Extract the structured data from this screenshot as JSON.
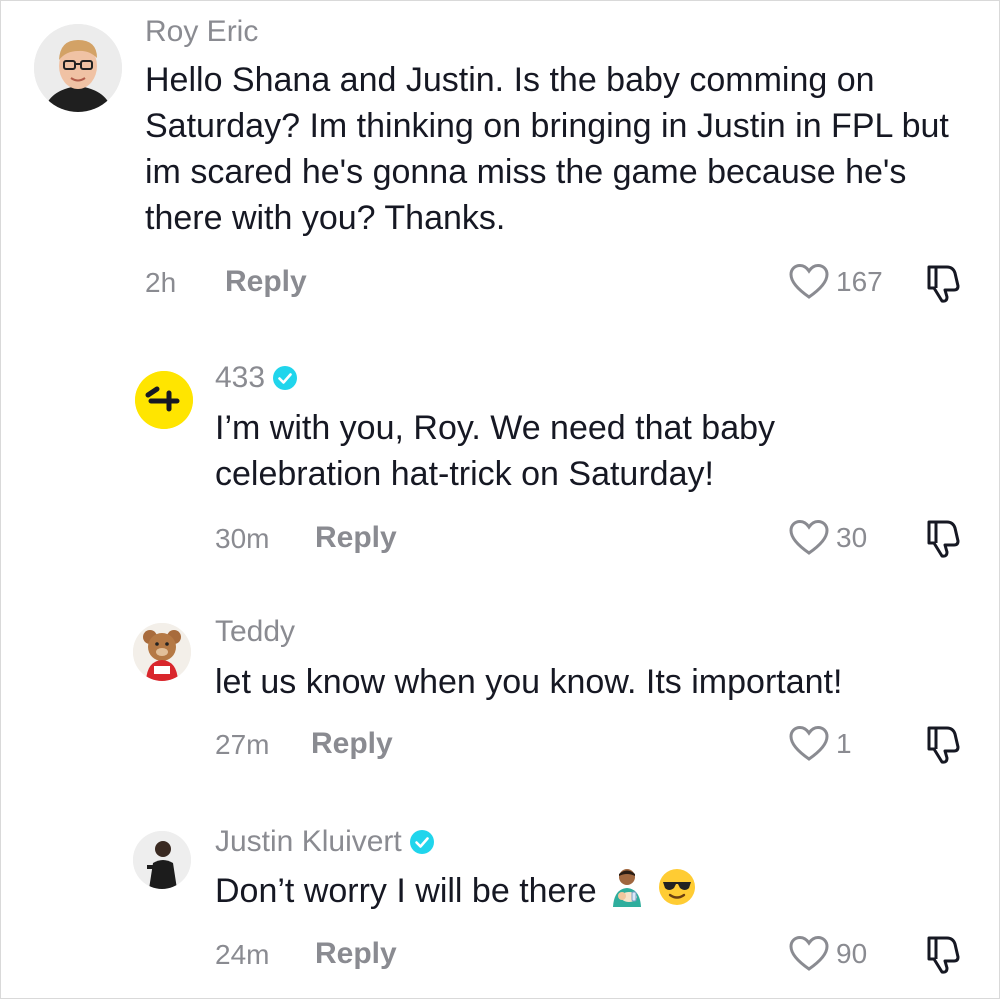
{
  "comments": [
    {
      "username": "Roy Eric",
      "verified": false,
      "text": "Hello Shana and Justin. Is the baby comming on Saturday? Im thinking on bringing in Justin in FPL but im scared he's gonna miss the game because he's there with you? Thanks.",
      "time": "2h",
      "reply_label": "Reply",
      "likes": "167"
    },
    {
      "username": "433",
      "verified": true,
      "text": "I’m with you, Roy. We need that baby celebration hat-trick on Saturday!",
      "time": "30m",
      "reply_label": "Reply",
      "likes": "30"
    },
    {
      "username": "Teddy",
      "verified": false,
      "text": "let us know when you know. Its important!",
      "time": "27m",
      "reply_label": "Reply",
      "likes": "1"
    },
    {
      "username": "Justin Kluivert",
      "verified": true,
      "text": "Don’t worry I will be there",
      "emojis": [
        "man-feeding-baby-emoji",
        "sunglasses-face-emoji"
      ],
      "time": "24m",
      "reply_label": "Reply",
      "likes": "90"
    }
  ],
  "colors": {
    "text": "#161823",
    "secondary": "#8a8b91",
    "verified": "#20d5ec",
    "brand_433": "#ffe500"
  }
}
